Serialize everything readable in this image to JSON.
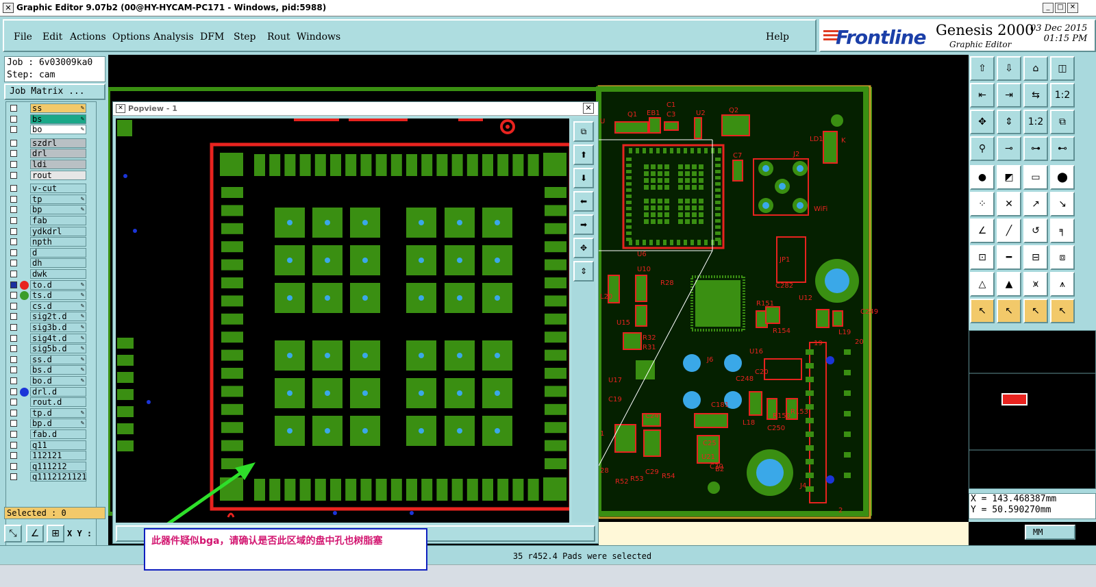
{
  "window": {
    "title": "Graphic Editor 9.07b2 (00@HY-HYCAM-PC171 - Windows, pid:5988)",
    "icon": "x-window-icon"
  },
  "menu": {
    "items": [
      "File",
      "Edit",
      "Actions",
      "Options",
      "Analysis",
      "DFM",
      "Step",
      "Rout",
      "Windows"
    ],
    "help": "Help"
  },
  "brand": {
    "logo": "Frontline",
    "product": "Genesis 2000",
    "subtitle": "Graphic Editor",
    "date": "03 Dec 2015",
    "time": "01:15 PM"
  },
  "job": {
    "job_label": "Job : 6v03009ka0",
    "step_label": "Step: cam",
    "matrix_button": "Job Matrix ..."
  },
  "layers": [
    {
      "name": "ss",
      "color": "#f2c96a",
      "pen": true
    },
    {
      "name": "bs",
      "color": "#1aa888",
      "pen": true
    },
    {
      "name": "bo",
      "color": "#ffffff",
      "pen": true
    },
    {
      "name": "szdrl",
      "color": "#b9c0c4",
      "pen": false
    },
    {
      "name": "drl",
      "color": "#b9c0c4",
      "pen": false
    },
    {
      "name": "ldi",
      "color": "#b9c0c4",
      "pen": false
    },
    {
      "name": "rout",
      "color": "#e6e6e6",
      "pen": false
    },
    {
      "name": "v-cut",
      "color": "#a9d9dd",
      "pen": false
    },
    {
      "name": "tp",
      "color": "#a9d9dd",
      "pen": true
    },
    {
      "name": "bp",
      "color": "#a9d9dd",
      "pen": true
    },
    {
      "name": "fab",
      "color": "#a9d9dd",
      "pen": false
    },
    {
      "name": "ydkdrl",
      "color": "#a9d9dd",
      "pen": false
    },
    {
      "name": "npth",
      "color": "#a9d9dd",
      "pen": false
    },
    {
      "name": "d",
      "color": "#a9d9dd",
      "pen": false
    },
    {
      "name": "dh",
      "color": "#a9d9dd",
      "pen": false
    },
    {
      "name": "dwk",
      "color": "#a9d9dd",
      "pen": false
    },
    {
      "name": "to.d",
      "color": "#a9d9dd",
      "pen": true,
      "dot": "#e8231f",
      "box": "#1b2fa0"
    },
    {
      "name": "ts.d",
      "color": "#a9d9dd",
      "pen": true,
      "dot": "#3a9d2a"
    },
    {
      "name": "cs.d",
      "color": "#a9d9dd",
      "pen": true
    },
    {
      "name": "sig2t.d",
      "color": "#a9d9dd",
      "pen": true
    },
    {
      "name": "sig3b.d",
      "color": "#a9d9dd",
      "pen": true
    },
    {
      "name": "sig4t.d",
      "color": "#a9d9dd",
      "pen": true
    },
    {
      "name": "sig5b.d",
      "color": "#a9d9dd",
      "pen": true
    },
    {
      "name": "ss.d",
      "color": "#a9d9dd",
      "pen": true
    },
    {
      "name": "bs.d",
      "color": "#a9d9dd",
      "pen": true
    },
    {
      "name": "bo.d",
      "color": "#a9d9dd",
      "pen": true
    },
    {
      "name": "drl.d",
      "color": "#a9d9dd",
      "pen": false,
      "dot": "#1b35d8"
    },
    {
      "name": "rout.d",
      "color": "#a9d9dd",
      "pen": false
    },
    {
      "name": "tp.d",
      "color": "#a9d9dd",
      "pen": true
    },
    {
      "name": "bp.d",
      "color": "#a9d9dd",
      "pen": true
    },
    {
      "name": "fab.d",
      "color": "#a9d9dd",
      "pen": false
    },
    {
      "name": "q11",
      "color": "#a9d9dd",
      "pen": false
    },
    {
      "name": "112121",
      "color": "#a9d9dd",
      "pen": false
    },
    {
      "name": "q111212",
      "color": "#a9d9dd",
      "pen": false
    },
    {
      "name": "q1112121121",
      "color": "#a9d9dd",
      "pen": false
    }
  ],
  "selection": {
    "label": "Selected : 0"
  },
  "xy": {
    "label": "X Y :"
  },
  "popview": {
    "title": "Popview - 1"
  },
  "coords": {
    "x": "X = 143.468387mm",
    "y": "Y = 50.590270mm"
  },
  "units": "MM",
  "status": "35 r452.4 Pads were selected",
  "annotation": "此器件疑似bga，请确认是否此区域的盘中孔也树脂塞",
  "board_labels": [
    "Q1",
    "EB1",
    "C1",
    "C3",
    "U2",
    "Q2",
    "LD1",
    "K",
    "J2",
    "WiFi",
    "C7",
    "U6",
    "JP1",
    "U10",
    "R28",
    "C282",
    "R151",
    "U12",
    "R154",
    "C249",
    "L19",
    "L20",
    "U15",
    "R32",
    "R31",
    "J6",
    "C248",
    "U16",
    "U17",
    "C19",
    "C181",
    "C24",
    "L18",
    "C250",
    "R150",
    "R153",
    "C25",
    "C29",
    "R52",
    "R53",
    "R54",
    "U21",
    "C30",
    "B2",
    "J4",
    "19",
    "20",
    "28",
    "1",
    "2",
    "C20",
    "U"
  ],
  "colors": {
    "ui": "#a9d9dd",
    "copper": "#3a8f12",
    "outline": "#e8231f",
    "drill": "#3aa8e8",
    "annotation_text": "#d21570",
    "annotation_border": "#0f1fbf",
    "arrow": "#2ee02a"
  }
}
